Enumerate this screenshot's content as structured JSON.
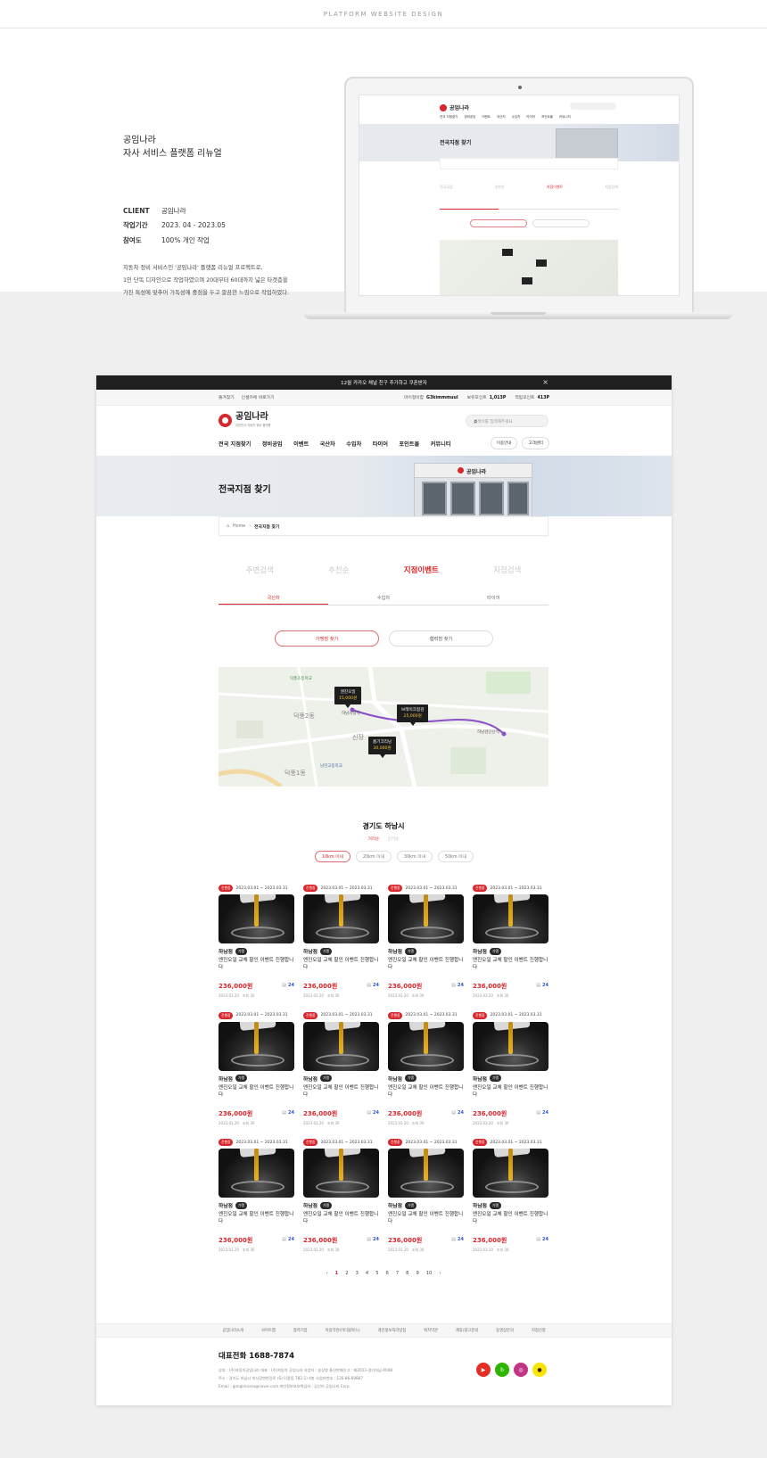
{
  "portfolio": {
    "label": "PLATFORM WEBSITE DESIGN",
    "title_line1": "공임나라",
    "title_line2": "자사 서비스 플랫폼 리뉴얼",
    "meta": [
      {
        "k": "CLIENT",
        "v": "공임나라"
      },
      {
        "k": "작업기간",
        "v": "2023. 04 - 2023.05"
      },
      {
        "k": "참여도",
        "v": "100% 개인 작업"
      }
    ],
    "desc_lines": [
      "지동차 정비 서비스인 '공임나라' 플랫폼 리뉴얼 프로젝트로,",
      "1인 단독 디자인으로 작업하였으며 20대부터 60대까지 넓은 타겟층을",
      "가진 특성에 맞추어 가독성에 중점을 두고 깔끔한 느낌으로 작업하였다."
    ]
  },
  "laptop": {
    "logo": "공임나라",
    "gnb": [
      "전국 지점찾기",
      "정비공임",
      "이벤트",
      "국산차",
      "수입차",
      "타이어",
      "포인트몰",
      "커뮤니티"
    ],
    "hero_title": "전국지점 찾기",
    "tabs": [
      "전국공임",
      "추천순",
      "지점이벤트",
      "지점검색"
    ]
  },
  "site": {
    "banner": "12월 카카오 채널 친구 추가하고 쿠폰받자",
    "close": "×",
    "util_left": [
      "즐겨찾기",
      "인셀카에 바로가기"
    ],
    "util_right": [
      {
        "label": "마이정비함",
        "value": "G3kimmmuul"
      },
      {
        "label": "보유포인트",
        "value": "1,013P"
      },
      {
        "label": "적립포인트",
        "value": "413P"
      }
    ],
    "logo": "공임나라",
    "logo_sub": "대한민국 자동차 정비 플랫폼",
    "search_placeholder": "검색어를 입력해주세요",
    "gnb": [
      "전국 지점찾기",
      "정비공임",
      "이벤트",
      "국산차",
      "수입차",
      "타이어",
      "포인트몰",
      "커뮤니티"
    ],
    "gnb_right": [
      "이용안내",
      "고객센터"
    ],
    "hero_title": "전국지점 찾기",
    "hero_store": "공임나라",
    "breadcrumb": {
      "home": "Home",
      "sep": "›",
      "current": "전국지점 찾기"
    },
    "tabs": [
      "주변검색",
      "추천순",
      "지점이벤트",
      "지점검색"
    ],
    "active_tab": 2,
    "subtabs": [
      "국산차",
      "수입차",
      "타이어"
    ],
    "pills": [
      "가맹점 찾기",
      "협력점 찾기"
    ],
    "map_pins": [
      {
        "name": "엔진오일",
        "price": "15,000원"
      },
      {
        "name": "브레이크점검",
        "price": "25,000원"
      },
      {
        "name": "흡기크리닝",
        "price": "30,000원"
      }
    ],
    "map_labels": [
      "덕풍2동",
      "신장",
      "덕풍1동",
      "하남시청역",
      "하남검단산역",
      "덕풍초등학교",
      "남한고등학교"
    ],
    "region": "경기도 하남시",
    "sort": [
      "거리순",
      "인기순"
    ],
    "distances": [
      "10km 이내",
      "20km 이내",
      "30km 이내",
      "50km 이내"
    ],
    "items": [
      {
        "badge": "진행중",
        "period": "2023.03.01 ~ 2023.03.31",
        "branch": "하남점",
        "tag": "가맹",
        "desc": "엔진오일 교체 할인 이벤트 진행합니다",
        "price": "236,000원",
        "count": "24",
        "date": "2023.03.20",
        "views": "조회 30"
      },
      {
        "badge": "진행중",
        "period": "2023.03.01 ~ 2023.03.31",
        "branch": "하남점",
        "tag": "가맹",
        "desc": "엔진오일 교체 할인 이벤트 진행합니다",
        "price": "236,000원",
        "count": "24",
        "date": "2023.03.20",
        "views": "조회 30"
      },
      {
        "badge": "진행중",
        "period": "2023.03.01 ~ 2023.03.31",
        "branch": "하남점",
        "tag": "가맹",
        "desc": "엔진오일 교체 할인 이벤트 진행합니다",
        "price": "236,000원",
        "count": "24",
        "date": "2023.03.20",
        "views": "조회 30"
      },
      {
        "badge": "진행중",
        "period": "2023.03.01 ~ 2023.03.31",
        "branch": "하남점",
        "tag": "가맹",
        "desc": "엔진오일 교체 할인 이벤트 진행합니다",
        "price": "236,000원",
        "count": "24",
        "date": "2023.03.20",
        "views": "조회 30"
      },
      {
        "badge": "진행중",
        "period": "2023.03.01 ~ 2023.03.31",
        "branch": "하남점",
        "tag": "가맹",
        "desc": "엔진오일 교체 할인 이벤트 진행합니다",
        "price": "236,000원",
        "count": "24",
        "date": "2023.03.20",
        "views": "조회 30"
      },
      {
        "badge": "진행중",
        "period": "2023.03.01 ~ 2023.03.31",
        "branch": "하남점",
        "tag": "가맹",
        "desc": "엔진오일 교체 할인 이벤트 진행합니다",
        "price": "236,000원",
        "count": "24",
        "date": "2023.03.20",
        "views": "조회 30"
      },
      {
        "badge": "진행중",
        "period": "2023.03.01 ~ 2023.03.31",
        "branch": "하남점",
        "tag": "가맹",
        "desc": "엔진오일 교체 할인 이벤트 진행합니다",
        "price": "236,000원",
        "count": "24",
        "date": "2023.03.20",
        "views": "조회 30"
      },
      {
        "badge": "진행중",
        "period": "2023.03.01 ~ 2023.03.31",
        "branch": "하남점",
        "tag": "가맹",
        "desc": "엔진오일 교체 할인 이벤트 진행합니다",
        "price": "236,000원",
        "count": "24",
        "date": "2023.03.20",
        "views": "조회 30"
      },
      {
        "badge": "진행중",
        "period": "2023.03.01 ~ 2023.03.31",
        "branch": "하남점",
        "tag": "가맹",
        "desc": "엔진오일 교체 할인 이벤트 진행합니다",
        "price": "236,000원",
        "count": "24",
        "date": "2023.03.20",
        "views": "조회 30"
      },
      {
        "badge": "진행중",
        "period": "2023.03.01 ~ 2023.03.31",
        "branch": "하남점",
        "tag": "가맹",
        "desc": "엔진오일 교체 할인 이벤트 진행합니다",
        "price": "236,000원",
        "count": "24",
        "date": "2023.03.20",
        "views": "조회 30"
      },
      {
        "badge": "진행중",
        "period": "2023.03.01 ~ 2023.03.31",
        "branch": "하남점",
        "tag": "가맹",
        "desc": "엔진오일 교체 할인 이벤트 진행합니다",
        "price": "236,000원",
        "count": "24",
        "date": "2023.03.20",
        "views": "조회 30"
      },
      {
        "badge": "진행중",
        "period": "2023.03.01 ~ 2023.03.31",
        "branch": "하남점",
        "tag": "가맹",
        "desc": "엔진오일 교체 할인 이벤트 진행합니다",
        "price": "236,000원",
        "count": "24",
        "date": "2023.03.20",
        "views": "조회 30"
      }
    ],
    "pagination": [
      "‹",
      "1",
      "2",
      "3",
      "4",
      "5",
      "6",
      "7",
      "8",
      "9",
      "10",
      "›"
    ],
    "active_page": "1",
    "footer_nav": [
      "공임나라소개",
      "사이트맵",
      "협력기업",
      "이용약관(이더블박스)",
      "개인정보처리방침",
      "위치약관",
      "제휴/광고문의",
      "동영상문의",
      "지점신청"
    ],
    "footer_tel": "대표전화  1688-7874",
    "footer_info": [
      "상호 : (주)자동차공임나라    대표 : (주)자동차 공임나라    사업자 : 송상명    통신판매신고 : 제2013-경기하남-0048",
      "주소 : 경기도 하남시 미사강변한강로 (S) 덕풍동 782-1) 4층    사업자번호 : 126-86-69887",
      "Email : gongimnara@naver.com    개인정보보호책임자 : 김선미 공임나라 Corp."
    ],
    "sns": [
      {
        "icon": "youtube-icon",
        "glyph": "▶",
        "color": "#e52d27"
      },
      {
        "icon": "naver-blog-icon",
        "glyph": "b",
        "color": "#2db400"
      },
      {
        "icon": "instagram-icon",
        "glyph": "◎",
        "color": "#c13584"
      },
      {
        "icon": "kakao-icon",
        "glyph": "●",
        "color": "#f7e600"
      }
    ],
    "colors": {
      "accent": "#d8272c",
      "dark": "#1f1f1f"
    }
  }
}
